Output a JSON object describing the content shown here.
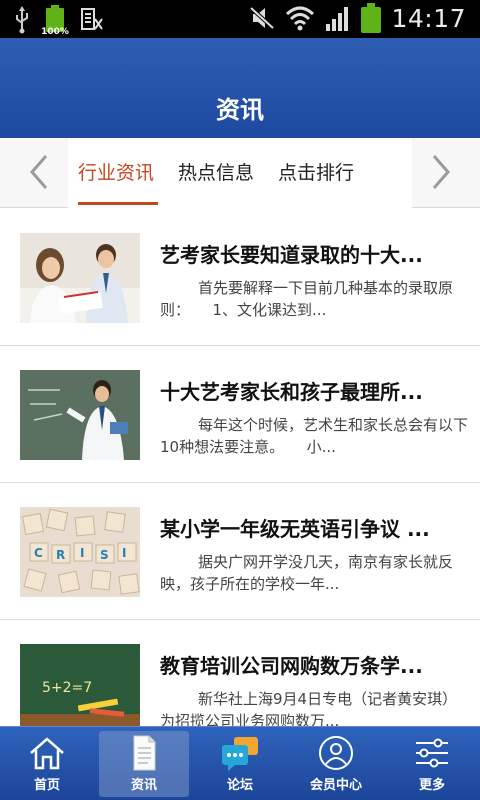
{
  "status_bar": {
    "time": "14:17",
    "battery_small_percent": "100%",
    "icons": [
      "usb-icon",
      "battery-icon",
      "sim-icon",
      "mute-icon",
      "wifi-icon",
      "signal-icon",
      "battery-icon"
    ]
  },
  "header": {
    "title": "资讯"
  },
  "tabs": [
    {
      "label": "行业资讯",
      "active": true
    },
    {
      "label": "热点信息",
      "active": false
    },
    {
      "label": "点击排行",
      "active": false
    }
  ],
  "news": [
    {
      "title": "艺考家长要知道录取的十大...",
      "summary": "首先要解释一下目前几种基本的录取原则：　　1、文化课达到..."
    },
    {
      "title": "十大艺考家长和孩子最理所...",
      "summary": "每年这个时候，艺术生和家长总会有以下10种想法要注意。　　小..."
    },
    {
      "title": "某小学一年级无英语引争议 ...",
      "summary": "据央广网开学没几天，南京有家长就反映，孩子所在的学校一年..."
    },
    {
      "title": "教育培训公司网购数万条学...",
      "summary": "新华社上海9月4日专电（记者黄安琪）为招揽公司业务网购数万..."
    }
  ],
  "bottom_nav": [
    {
      "label": "首页",
      "icon": "home-icon"
    },
    {
      "label": "资讯",
      "icon": "document-icon",
      "active": true
    },
    {
      "label": "论坛",
      "icon": "chat-icon"
    },
    {
      "label": "会员中心",
      "icon": "user-icon"
    },
    {
      "label": "更多",
      "icon": "sliders-icon"
    }
  ],
  "colors": {
    "header_blue": "#2e5db4",
    "tab_active": "#c8451f",
    "battery_green": "#5fb318"
  }
}
